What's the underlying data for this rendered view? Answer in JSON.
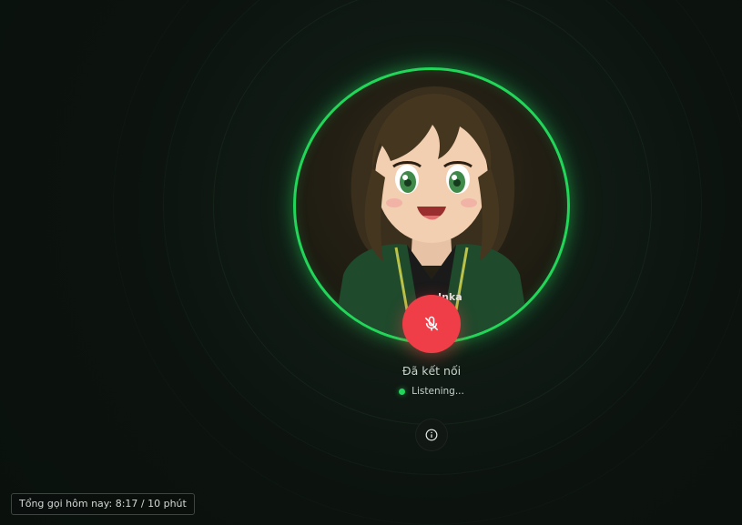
{
  "avatar": {
    "character_name": "Inka",
    "icon": "anime-girl-avatar",
    "ring_color": "#22d65a"
  },
  "mic_button": {
    "icon": "mic-off-icon",
    "color": "#ef3e48",
    "state": "muted"
  },
  "status": {
    "connection": "Đã kết nối",
    "activity": "Listening...",
    "dot_color": "#22d65a"
  },
  "info_button": {
    "icon": "info-icon"
  },
  "usage": {
    "label": "Tổng gọi hôm nay: 8:17 / 10 phút"
  }
}
